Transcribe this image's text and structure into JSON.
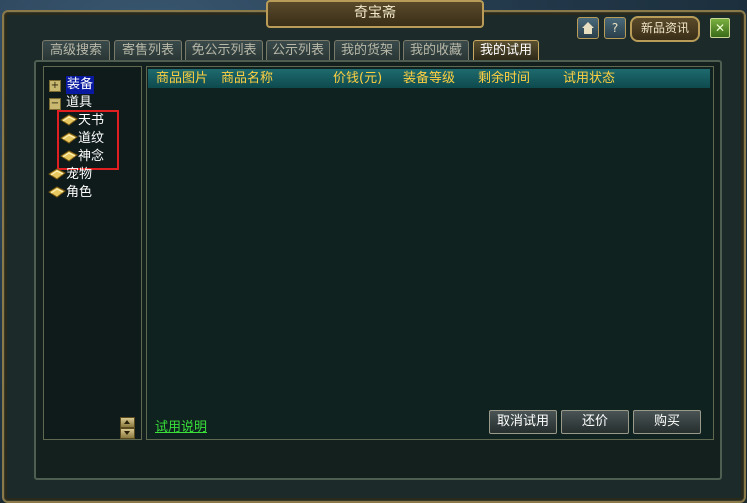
{
  "window": {
    "title": "奇宝斋"
  },
  "header": {
    "home_icon": "home-icon",
    "help_label": "?",
    "news_label": "新品资讯",
    "close_label": "✕"
  },
  "tabs": [
    {
      "label": "高级搜索",
      "active": false
    },
    {
      "label": "寄售列表",
      "active": false
    },
    {
      "label": "免公示列表",
      "active": false
    },
    {
      "label": "公示列表",
      "active": false
    },
    {
      "label": "我的货架",
      "active": false
    },
    {
      "label": "我的收藏",
      "active": false
    },
    {
      "label": "我的试用",
      "active": true
    }
  ],
  "tree": {
    "equip": {
      "label": "装备",
      "expander": "+"
    },
    "item": {
      "label": "道具",
      "expander": "−"
    },
    "children": [
      "天书",
      "道纹",
      "神念"
    ],
    "pet": {
      "label": "宠物"
    },
    "role": {
      "label": "角色"
    }
  },
  "table": {
    "columns": [
      "商品图片",
      "商品名称",
      "价钱(元)",
      "装备等级",
      "剩余时间",
      "试用状态"
    ],
    "rows": []
  },
  "footer": {
    "guide_link": "试用说明",
    "cancel_trial": "取消试用",
    "counter_offer": "还价",
    "buy": "购买"
  },
  "colors": {
    "header_text": "#ffd040",
    "link": "#38e038",
    "highlight_box": "#e02020"
  }
}
